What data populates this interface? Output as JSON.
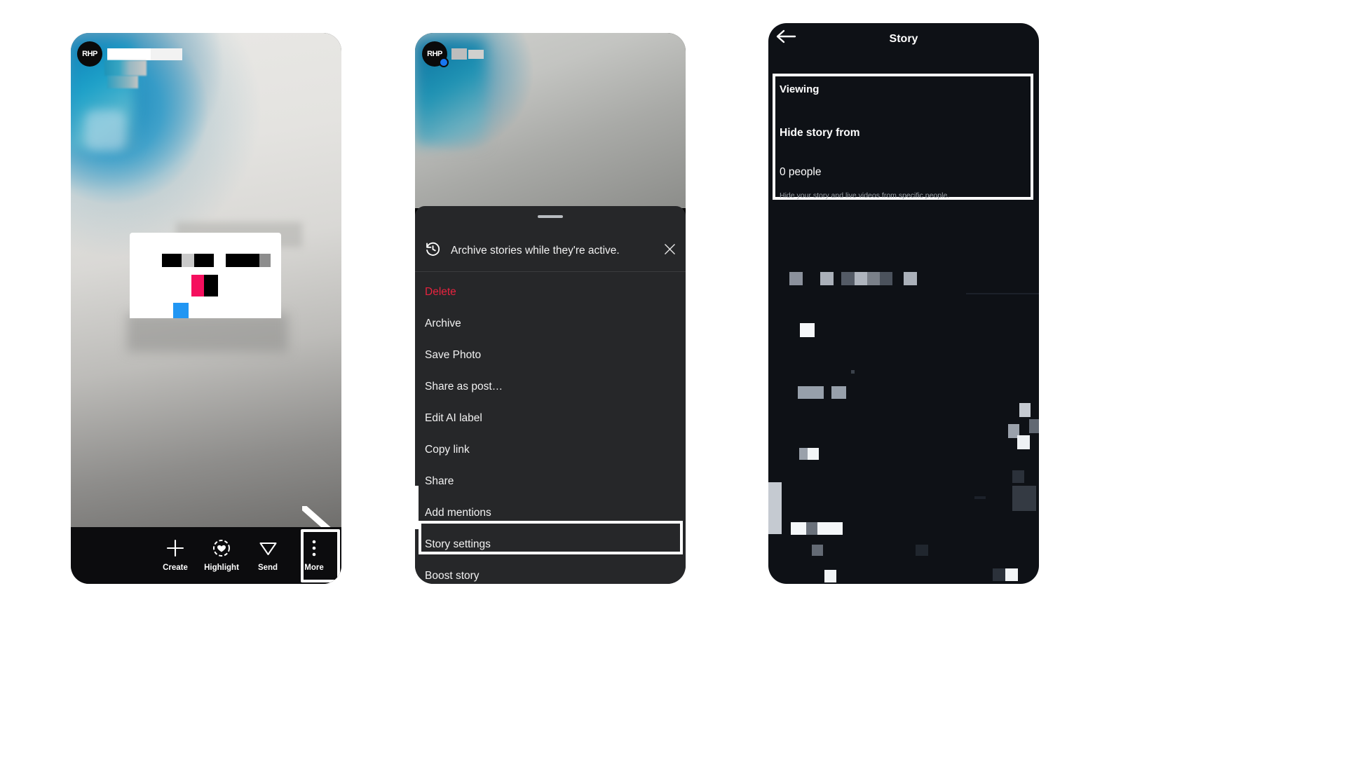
{
  "panels": [
    {
      "id": "story-view",
      "avatar_label": "RHP",
      "toolbar": [
        {
          "label": "Create",
          "icon": "plus-icon"
        },
        {
          "label": "Highlight",
          "icon": "highlight-heart-icon"
        },
        {
          "label": "Send",
          "icon": "send-paper-plane-icon"
        },
        {
          "label": "More",
          "icon": "three-dots-vertical-icon"
        }
      ],
      "highlighted_tool": "More"
    },
    {
      "id": "story-options-sheet",
      "avatar_label": "RHP",
      "archive_row": {
        "icon": "history-clock-icon",
        "text": "Archive stories while they're active.",
        "close_icon": "close-x-icon"
      },
      "menu_items": [
        {
          "label": "Delete",
          "style": "danger"
        },
        {
          "label": "Archive",
          "style": "normal"
        },
        {
          "label": "Save Photo",
          "style": "normal"
        },
        {
          "label": "Share as post…",
          "style": "normal"
        },
        {
          "label": "Edit AI label",
          "style": "normal"
        },
        {
          "label": "Copy link",
          "style": "normal"
        },
        {
          "label": "Share",
          "style": "normal"
        },
        {
          "label": "Add mentions",
          "style": "normal"
        },
        {
          "label": "Story settings",
          "style": "normal"
        },
        {
          "label": "Boost story",
          "style": "normal"
        }
      ],
      "highlighted_item": "Story settings"
    },
    {
      "id": "story-settings",
      "header": {
        "title": "Story",
        "back_icon": "back-arrow-icon"
      },
      "section": {
        "label": "Viewing",
        "row_title": "Hide story from",
        "row_value": "0 people",
        "row_description": "Hide your story and live videos from specific people."
      }
    }
  ],
  "colors": {
    "danger": "#e8233f",
    "sheet_bg": "#262729",
    "panel3_bg": "#0e1116",
    "highlight_border": "#ffffff",
    "accent_blue": "#2196f3",
    "accent_pink": "#f50f5e"
  }
}
